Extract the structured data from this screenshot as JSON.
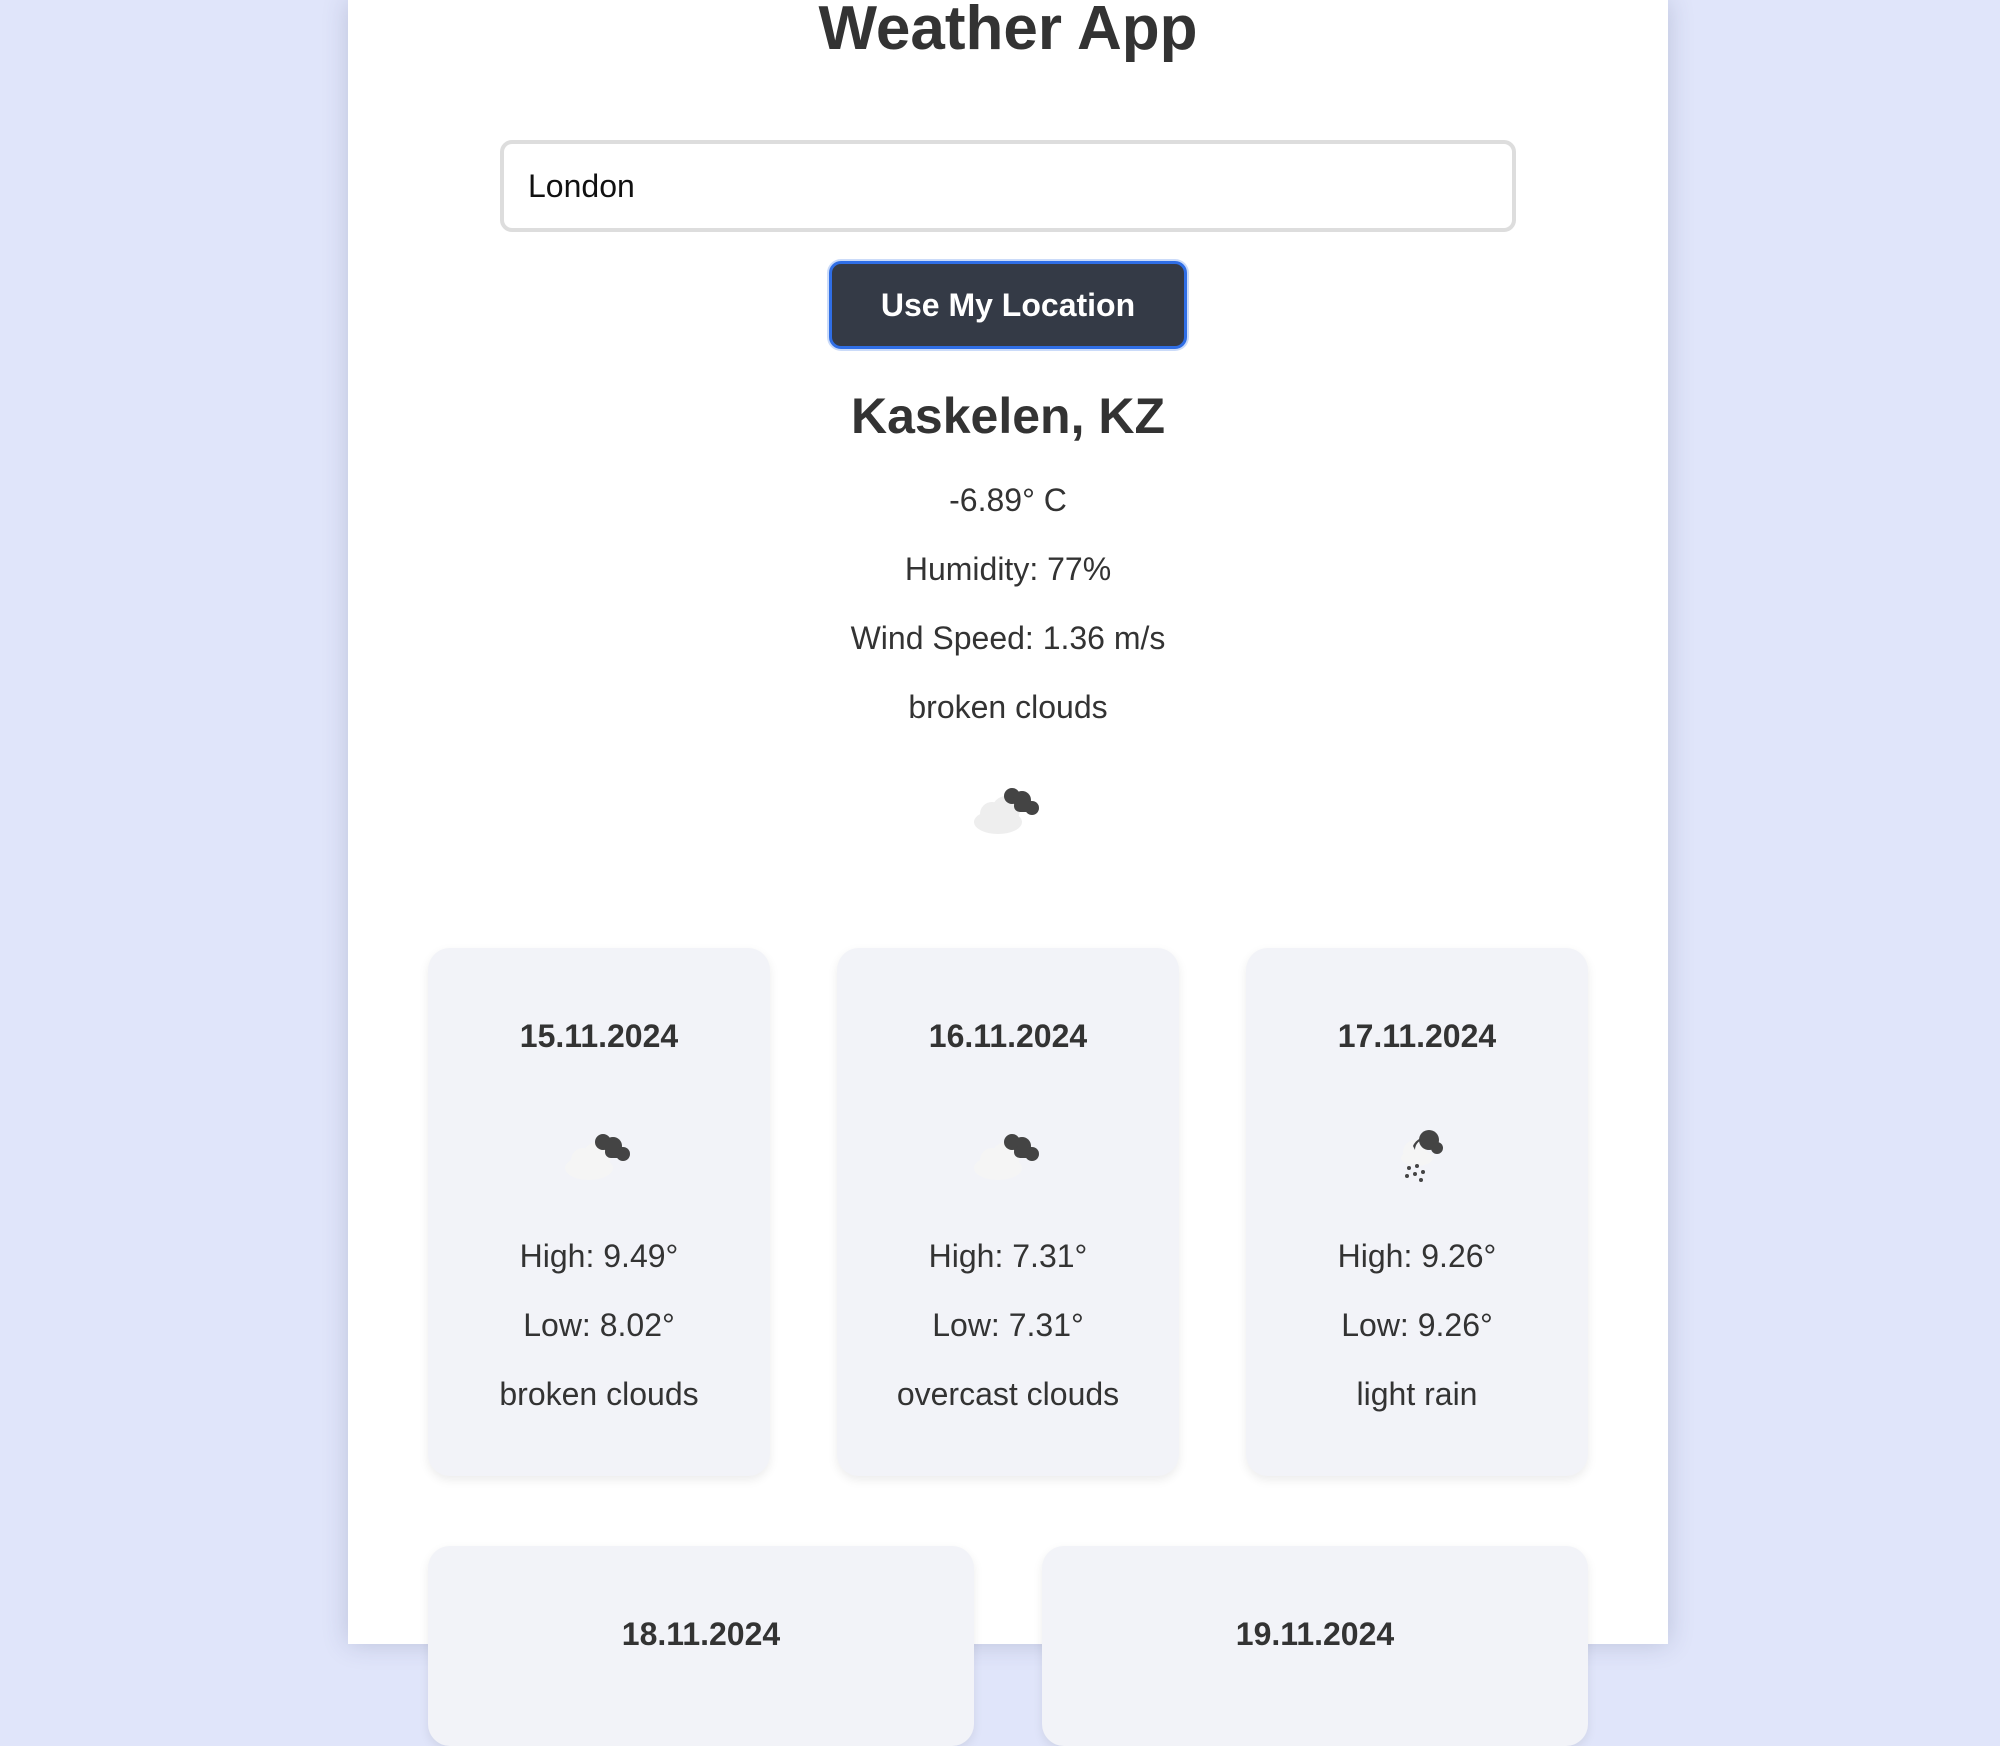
{
  "app": {
    "title": "Weather App"
  },
  "search": {
    "value": "London"
  },
  "location_button": {
    "label": "Use My Location"
  },
  "current": {
    "city": "Kaskelen, KZ",
    "temperature": "-6.89° C",
    "humidity": "Humidity: 77%",
    "wind": "Wind Speed: 1.36 m/s",
    "description": "broken clouds",
    "icon": "broken-clouds-icon"
  },
  "forecast": [
    {
      "date": "15.11.2024",
      "icon": "broken-clouds-icon",
      "high": "High: 9.49°",
      "low": "Low: 8.02°",
      "description": "broken clouds"
    },
    {
      "date": "16.11.2024",
      "icon": "overcast-clouds-icon",
      "high": "High: 7.31°",
      "low": "Low: 7.31°",
      "description": "overcast clouds"
    },
    {
      "date": "17.11.2024",
      "icon": "light-rain-icon",
      "high": "High: 9.26°",
      "low": "Low: 9.26°",
      "description": "light rain"
    },
    {
      "date": "18.11.2024"
    },
    {
      "date": "19.11.2024"
    }
  ]
}
